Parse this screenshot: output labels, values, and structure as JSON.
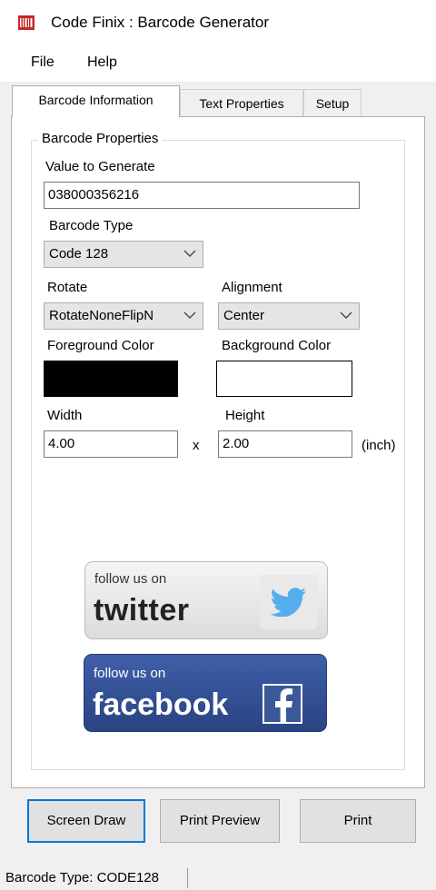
{
  "window": {
    "title": "Code Finix : Barcode Generator",
    "icon": "app-barcode-icon"
  },
  "menu": {
    "items": [
      "File",
      "Help"
    ]
  },
  "tabs": [
    "Barcode Information",
    "Text Properties",
    "Setup"
  ],
  "group": {
    "title": "Barcode Properties"
  },
  "fields": {
    "value_label": "Value to Generate",
    "value": "038000356216",
    "type_label": "Barcode Type",
    "type_value": "Code 128",
    "rotate_label": "Rotate",
    "rotate_value": "RotateNoneFlipN",
    "alignment_label": "Alignment",
    "alignment_value": "Center",
    "foreground_label": "Foreground Color",
    "foreground_color": "#000000",
    "background_label": "Background Color",
    "background_color": "#ffffff",
    "width_label": "Width",
    "width_value": "4.00",
    "times": "x",
    "height_label": "Height",
    "height_value": "2.00",
    "unit": "(inch)"
  },
  "social": {
    "twitter_small": "follow us on",
    "twitter_big": "twitter",
    "facebook_small": "follow us on",
    "facebook_big": "facebook",
    "twitter_color": "#55acee",
    "facebook_color": "#34529a"
  },
  "buttons": {
    "screen_draw": "Screen Draw",
    "print_preview": "Print Preview",
    "print": "Print"
  },
  "status": {
    "text": "Barcode Type: CODE128"
  }
}
